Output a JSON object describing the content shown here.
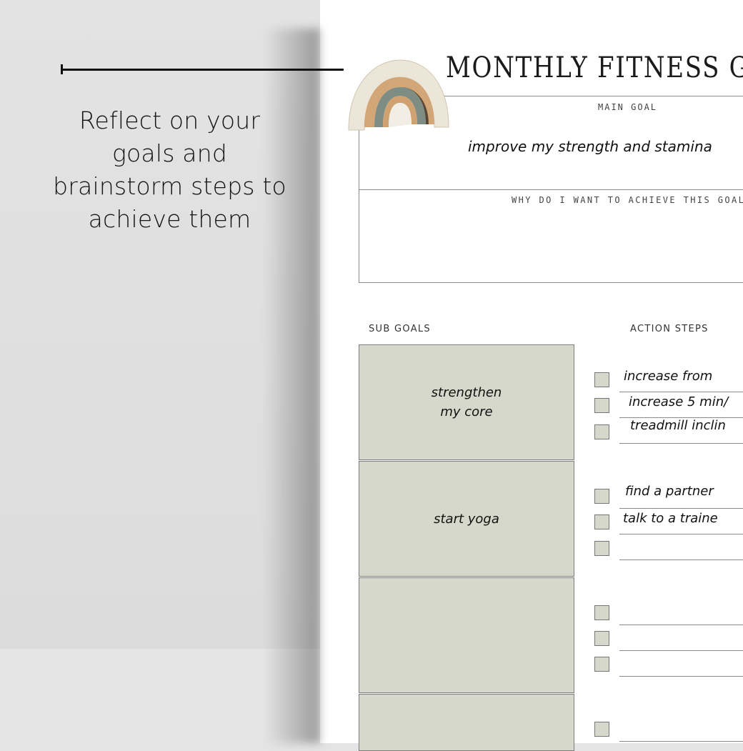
{
  "sidebar": {
    "caption": "Reflect on your goals and brainstorm steps to achieve them"
  },
  "planner": {
    "title": "MONTHLY FITNESS GO",
    "decoration": "rainbow-illustration",
    "main_goal": {
      "label": "MAIN GOAL",
      "value": "improve my strength and stamina"
    },
    "why": {
      "label": "WHY DO I WANT TO ACHIEVE THIS GOAL?",
      "value": ""
    },
    "sub_goals_label": "SUB GOALS",
    "action_steps_label": "ACTION STEPS",
    "sub_goals": [
      {
        "text": "strengthen\nmy core",
        "steps": [
          {
            "text": "increase from",
            "checked": false
          },
          {
            "text": "increase 5 min/",
            "checked": false
          },
          {
            "text": "treadmill inclin",
            "checked": false
          }
        ]
      },
      {
        "text": "start yoga",
        "steps": [
          {
            "text": "find a partner",
            "checked": false
          },
          {
            "text": "talk to a traine",
            "checked": false
          },
          {
            "text": "",
            "checked": false
          }
        ]
      },
      {
        "text": "",
        "steps": [
          {
            "text": "",
            "checked": false
          },
          {
            "text": "",
            "checked": false
          },
          {
            "text": "",
            "checked": false
          }
        ]
      },
      {
        "text": "",
        "steps": [
          {
            "text": "",
            "checked": false
          }
        ]
      }
    ]
  },
  "colors": {
    "subgoal_fill": "#d6d8cb",
    "background": "#e4e4e4",
    "page": "#ffffff"
  }
}
